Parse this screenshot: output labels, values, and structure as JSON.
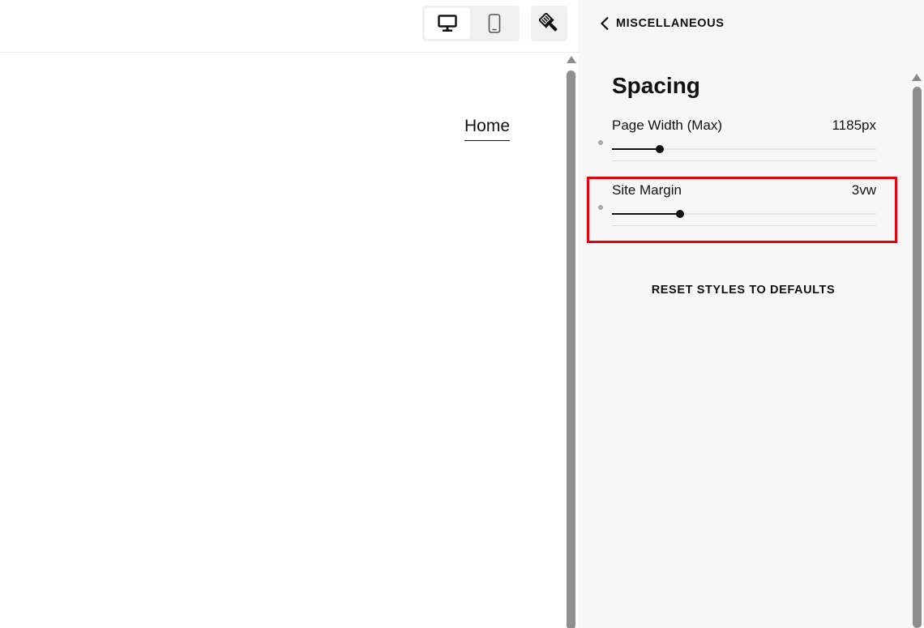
{
  "toolbar": {
    "device_desktop_icon": "desktop-monitor-icon",
    "device_mobile_icon": "mobile-phone-icon",
    "site_styles_icon": "paint-brush-icon"
  },
  "preview": {
    "nav_items": [
      "Home"
    ]
  },
  "panel": {
    "back_label": "MISCELLANEOUS",
    "section_title": "Spacing",
    "settings": [
      {
        "label": "Page Width (Max)",
        "value": "1185px",
        "slider_fraction": 0.18
      },
      {
        "label": "Site Margin",
        "value": "3vw",
        "slider_fraction": 0.257
      }
    ],
    "reset_label": "RESET STYLES TO DEFAULTS"
  },
  "colors": {
    "highlight": "#e8000b",
    "panel_bg": "#f7f7f7",
    "toggle_bg": "#f0f0f0"
  }
}
